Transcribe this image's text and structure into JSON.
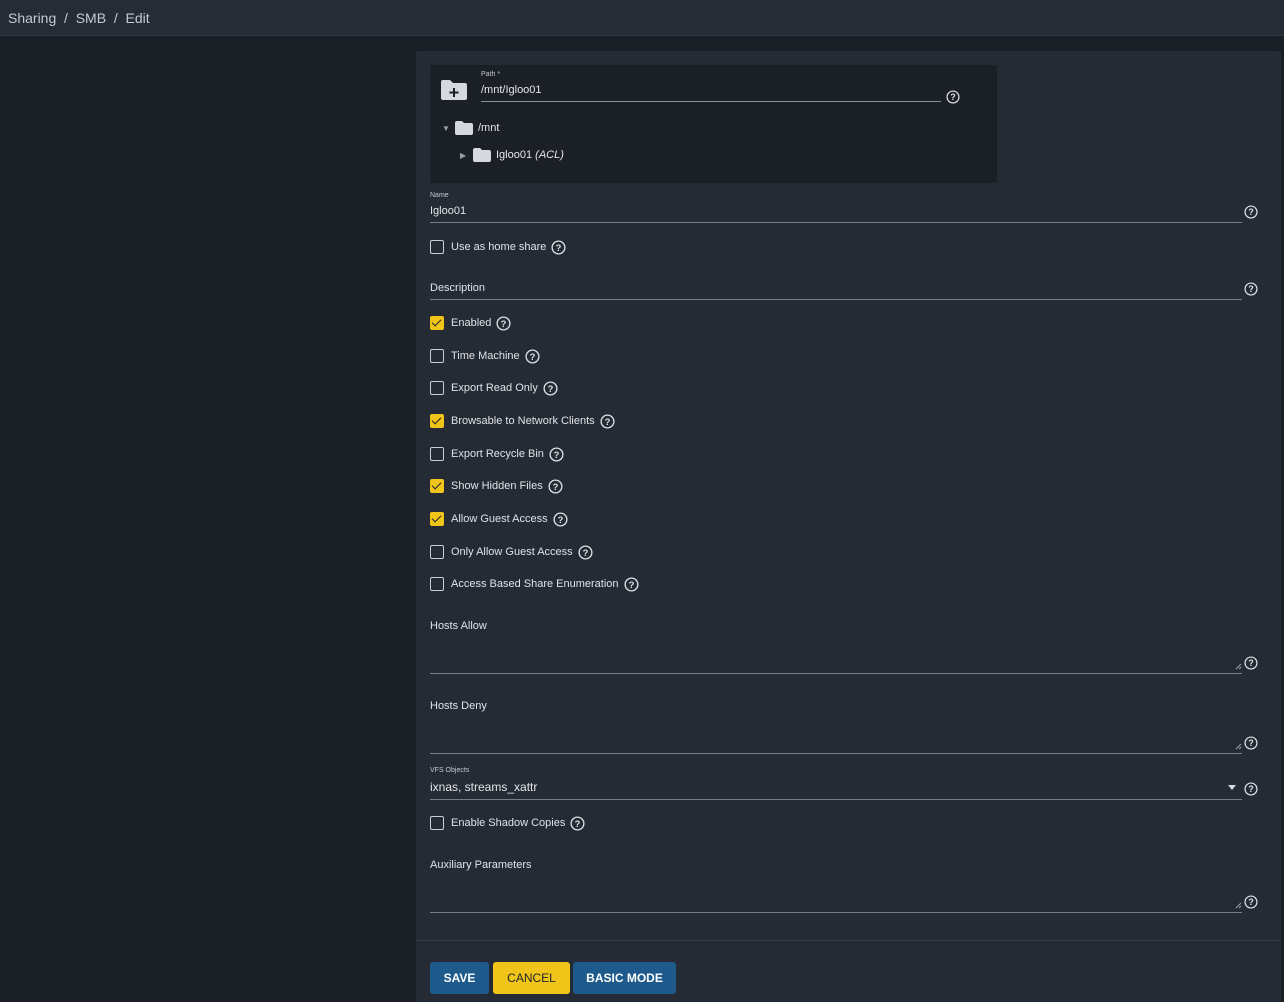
{
  "breadcrumb": {
    "items": [
      "Sharing",
      "SMB",
      "Edit"
    ],
    "separator": "/"
  },
  "path": {
    "label": "Path *",
    "value": "/mnt/Igloo01",
    "tree": {
      "root": "/mnt",
      "child": "Igloo01",
      "child_suffix": "(ACL)"
    }
  },
  "name": {
    "label": "Name",
    "value": "Igloo01"
  },
  "description": {
    "label": "Description",
    "value": ""
  },
  "checkboxes": {
    "home_share": {
      "label": "Use as home share",
      "checked": false
    },
    "enabled": {
      "label": "Enabled",
      "checked": true
    },
    "time_machine": {
      "label": "Time Machine",
      "checked": false
    },
    "export_read_only": {
      "label": "Export Read Only",
      "checked": false
    },
    "browsable": {
      "label": "Browsable to Network Clients",
      "checked": true
    },
    "recycle_bin": {
      "label": "Export Recycle Bin",
      "checked": false
    },
    "hidden_files": {
      "label": "Show Hidden Files",
      "checked": true
    },
    "guest_access": {
      "label": "Allow Guest Access",
      "checked": true
    },
    "only_guest": {
      "label": "Only Allow Guest Access",
      "checked": false
    },
    "abe": {
      "label": "Access Based Share Enumeration",
      "checked": false
    },
    "shadow_copies": {
      "label": "Enable Shadow Copies",
      "checked": false
    }
  },
  "hosts_allow": {
    "label": "Hosts Allow",
    "value": ""
  },
  "hosts_deny": {
    "label": "Hosts Deny",
    "value": ""
  },
  "vfs": {
    "label": "VFS Objects",
    "value": "ixnas, streams_xattr"
  },
  "aux": {
    "label": "Auxiliary Parameters",
    "value": ""
  },
  "buttons": {
    "save": "SAVE",
    "cancel": "CANCEL",
    "basic": "BASIC MODE"
  },
  "colors": {
    "accent": "#f0c419",
    "primary": "#1e5a8c",
    "panel": "#252b35",
    "background": "#1a1f26"
  }
}
